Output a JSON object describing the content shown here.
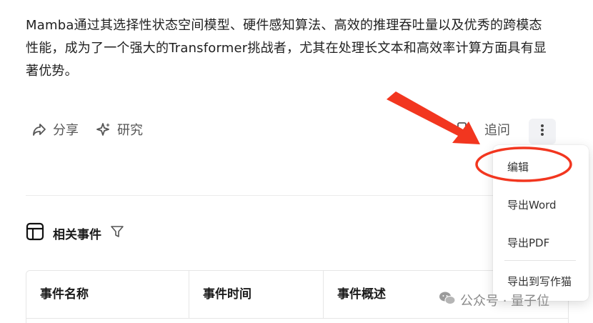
{
  "answer": {
    "text": "Mamba通过其选择性状态空间模型、硬件感知算法、高效的推理吞吐量以及优秀的跨模态性能，成为了一个强大的Transformer挑战者，尤其在处理长文本和高效率计算方面具有显著优势。"
  },
  "actions": {
    "share": "分享",
    "research": "研究",
    "followup": "追问"
  },
  "related": {
    "title": "相关事件"
  },
  "table": {
    "columns": [
      "事件名称",
      "事件时间",
      "事件概述"
    ]
  },
  "menu": {
    "items": [
      "编辑",
      "导出Word",
      "导出PDF",
      "导出到写作猫"
    ]
  },
  "watermark": {
    "text": "公众号 · 量子位"
  },
  "colors": {
    "arrow": "#f2361f",
    "accent_gray": "#f1f2f5"
  }
}
